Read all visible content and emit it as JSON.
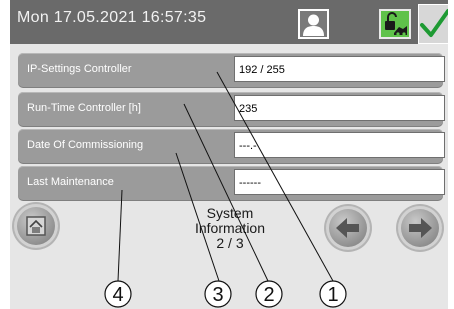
{
  "header": {
    "datetime": "Mon 17.05.2021  16:57:35",
    "user_icon": "user-icon",
    "lock_icon": "lock-unlocked-icon",
    "check_icon": "checkmark-icon"
  },
  "rows": [
    {
      "label": "IP-Settings Controller",
      "value": "192 / 255"
    },
    {
      "label": "Run-Time Controller [h]",
      "value": "235"
    },
    {
      "label": "Date Of Commissioning",
      "value": "---.-"
    },
    {
      "label": "Last Maintenance",
      "value": "------"
    }
  ],
  "page": {
    "title_line1": "System",
    "title_line2": "Information",
    "page_indicator": "2 / 3"
  },
  "callouts": [
    "1",
    "2",
    "3",
    "4"
  ],
  "colors": {
    "header_bg": "#6a6a6a",
    "row_bg": "#9b9b9b",
    "accent_green": "#5fc24a",
    "check_green": "#1e9a33"
  }
}
